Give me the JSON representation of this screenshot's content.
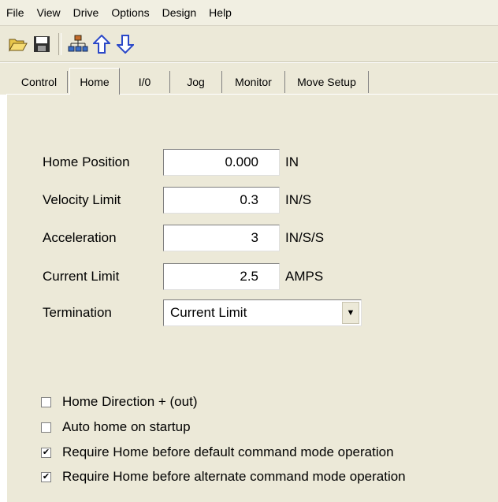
{
  "menu": [
    "File",
    "View",
    "Drive",
    "Options",
    "Design",
    "Help"
  ],
  "toolbar": {
    "icons": [
      "open-folder-icon",
      "save-icon",
      "network-icon",
      "upload-arrow-icon",
      "download-arrow-icon"
    ]
  },
  "tabs": [
    {
      "label": "Control",
      "active": false
    },
    {
      "label": "Home",
      "active": true
    },
    {
      "label": "I/0",
      "active": false
    },
    {
      "label": "Jog",
      "active": false
    },
    {
      "label": "Monitor",
      "active": false
    },
    {
      "label": "Move Setup",
      "active": false
    }
  ],
  "fields": [
    {
      "label": "Home Position",
      "value": "0.000",
      "unit": "IN"
    },
    {
      "label": "Velocity Limit",
      "value": "0.3",
      "unit": "IN/S"
    },
    {
      "label": "Acceleration",
      "value": "3",
      "unit": "IN/S/S"
    },
    {
      "label": "Current Limit",
      "value": "2.5",
      "unit": "AMPS"
    }
  ],
  "termination": {
    "label": "Termination",
    "value": "Current Limit"
  },
  "checkboxes": [
    {
      "label": "Home Direction + (out)",
      "checked": false
    },
    {
      "label": "Auto home on startup",
      "checked": false
    },
    {
      "label": "Require Home before default command mode operation",
      "checked": true
    },
    {
      "label": "Require Home before alternate command mode operation",
      "checked": true
    }
  ],
  "colors": {
    "window_bg": "#ece9d8",
    "menubar_bg": "#f1efe2",
    "icon_blue": "#2b48c8"
  }
}
